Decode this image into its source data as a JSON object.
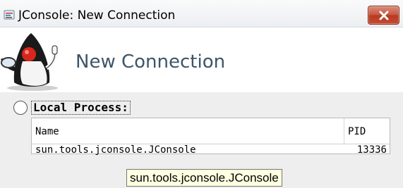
{
  "window": {
    "title": "JConsole: New Connection",
    "app_icon": "jconsole-app-icon",
    "close_icon": "close-icon"
  },
  "banner": {
    "logo": "duke-mascot-icon",
    "title": "New Connection"
  },
  "local_process": {
    "label": "Local Process:",
    "selected": false,
    "table": {
      "columns": [
        "Name",
        "PID"
      ],
      "rows": [
        {
          "name": "sun.tools.jconsole.JConsole",
          "pid": "13336"
        }
      ]
    }
  },
  "tooltip": {
    "text": "sun.tools.jconsole.JConsole"
  },
  "colors": {
    "banner_title": "#3d5568",
    "close_button": "#c7553d",
    "tooltip_bg": "#ffffe1"
  }
}
